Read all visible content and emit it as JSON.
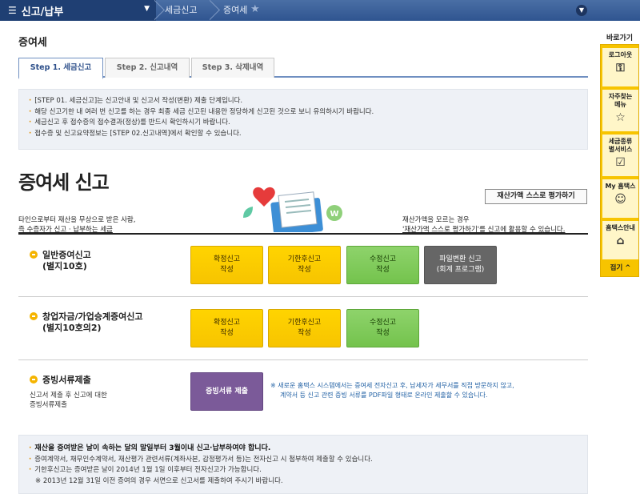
{
  "topbar": {
    "menu_label": "신고/납부",
    "breadcrumb_1": "세금신고",
    "breadcrumb_2": "증여세"
  },
  "page_title": "증여세",
  "tabs": [
    {
      "label": "Step 1. 세금신고",
      "active": true
    },
    {
      "label": "Step 2. 신고내역",
      "active": false
    },
    {
      "label": "Step 3. 삭제내역",
      "active": false
    }
  ],
  "notice_top": [
    "[STEP 01. 세금신고]는 신고안내 및 신고서 작성(변환) 제출 단계입니다.",
    "해당 신고기한 내 여러 번 신고를 하는 경우 최종 세금 신고된 내용만 정당하게 신고된 것으로 보니 유의하시기 바랍니다.",
    "세금신고 후 접수증의 접수결과(정상)를 반드시 확인하시기 바랍니다.",
    "접수증 및 신고요약정보는 [STEP 02.신고내역]에서 확인할 수 있습니다."
  ],
  "main_title": "증여세 신고",
  "eval_button": "재산가액 스스로 평가하기",
  "left_desc": [
    "타인으로부터 재산을 무상으로 받은 사람,",
    "즉 수증자가 신고 · 납부하는 세금"
  ],
  "right_desc": [
    "재산가액을 모르는 경우",
    "'재산가액 스스로 평가하기'를 신고에 활용할 수 있습니다."
  ],
  "sections": {
    "general": {
      "title": "일반증여신고",
      "subtitle": "(별지10호)",
      "buttons": {
        "confirm": [
          "확정신고",
          "작성"
        ],
        "late": [
          "기한후신고",
          "작성"
        ],
        "amend": [
          "수정신고",
          "작성"
        ],
        "convert": [
          "파일변환 신고",
          "(회계 프로그램)"
        ]
      }
    },
    "startup": {
      "title": "창업자금/가업승계증여신고",
      "subtitle": "(별지10호의2)",
      "buttons": {
        "confirm": [
          "확정신고",
          "작성"
        ],
        "late": [
          "기한후신고",
          "작성"
        ],
        "amend": [
          "수정신고",
          "작성"
        ]
      }
    },
    "evidence": {
      "title": "증빙서류제출",
      "desc": [
        "신고서 제출 후 신고에 대한",
        "증빙서류제출"
      ],
      "button": "증빙서류 제출",
      "note": [
        "※ 새로운 홈택스 시스템에서는 증여세 전자신고 후, 납세자가 세무서를 직접 방문하지 않고,",
        "계약서 등 신고 관련 증빙 서류를 PDF파일 형태로 온라인 제출할 수 있습니다."
      ]
    }
  },
  "notice_bottom": [
    "재산을 증여받은 날이 속하는 달의 말일부터 3월이내 신고·납부하여야 합니다.",
    "증여계약서, 채무인수계약서, 재산평가 관련서류(계좌사본, 감정평가서 등)는 전자신고 시 첨부하여 제출할 수 있습니다.",
    "기한후신고는 증여받은 날이 2014년 1월 1일 이후부터 전자신고가 가능합니다.",
    "※ 2013년 12월 31일 이전 증여의 경우 서면으로 신고서를 제출하여 주시기 바랍니다."
  ],
  "quick_menu": {
    "title": "바로가기",
    "items": [
      {
        "label": "로그아웃",
        "icon": "lock-icon"
      },
      {
        "label": "자주찾는메뉴",
        "icon": "star-icon"
      },
      {
        "label": "세금종류별서비스",
        "icon": "checkbox-icon"
      },
      {
        "label": "My 홈택스",
        "icon": "person-icon"
      },
      {
        "label": "홈택스안내",
        "icon": "home-guide-icon"
      }
    ],
    "close_label": "접기 ^"
  },
  "colors": {
    "topbar": "#2f5590",
    "yellow_button": "#f7c400",
    "green_button": "#74c34d",
    "gray_button": "#666666",
    "purple_button": "#7b5a99",
    "accent_bullet": "#f5b400"
  }
}
